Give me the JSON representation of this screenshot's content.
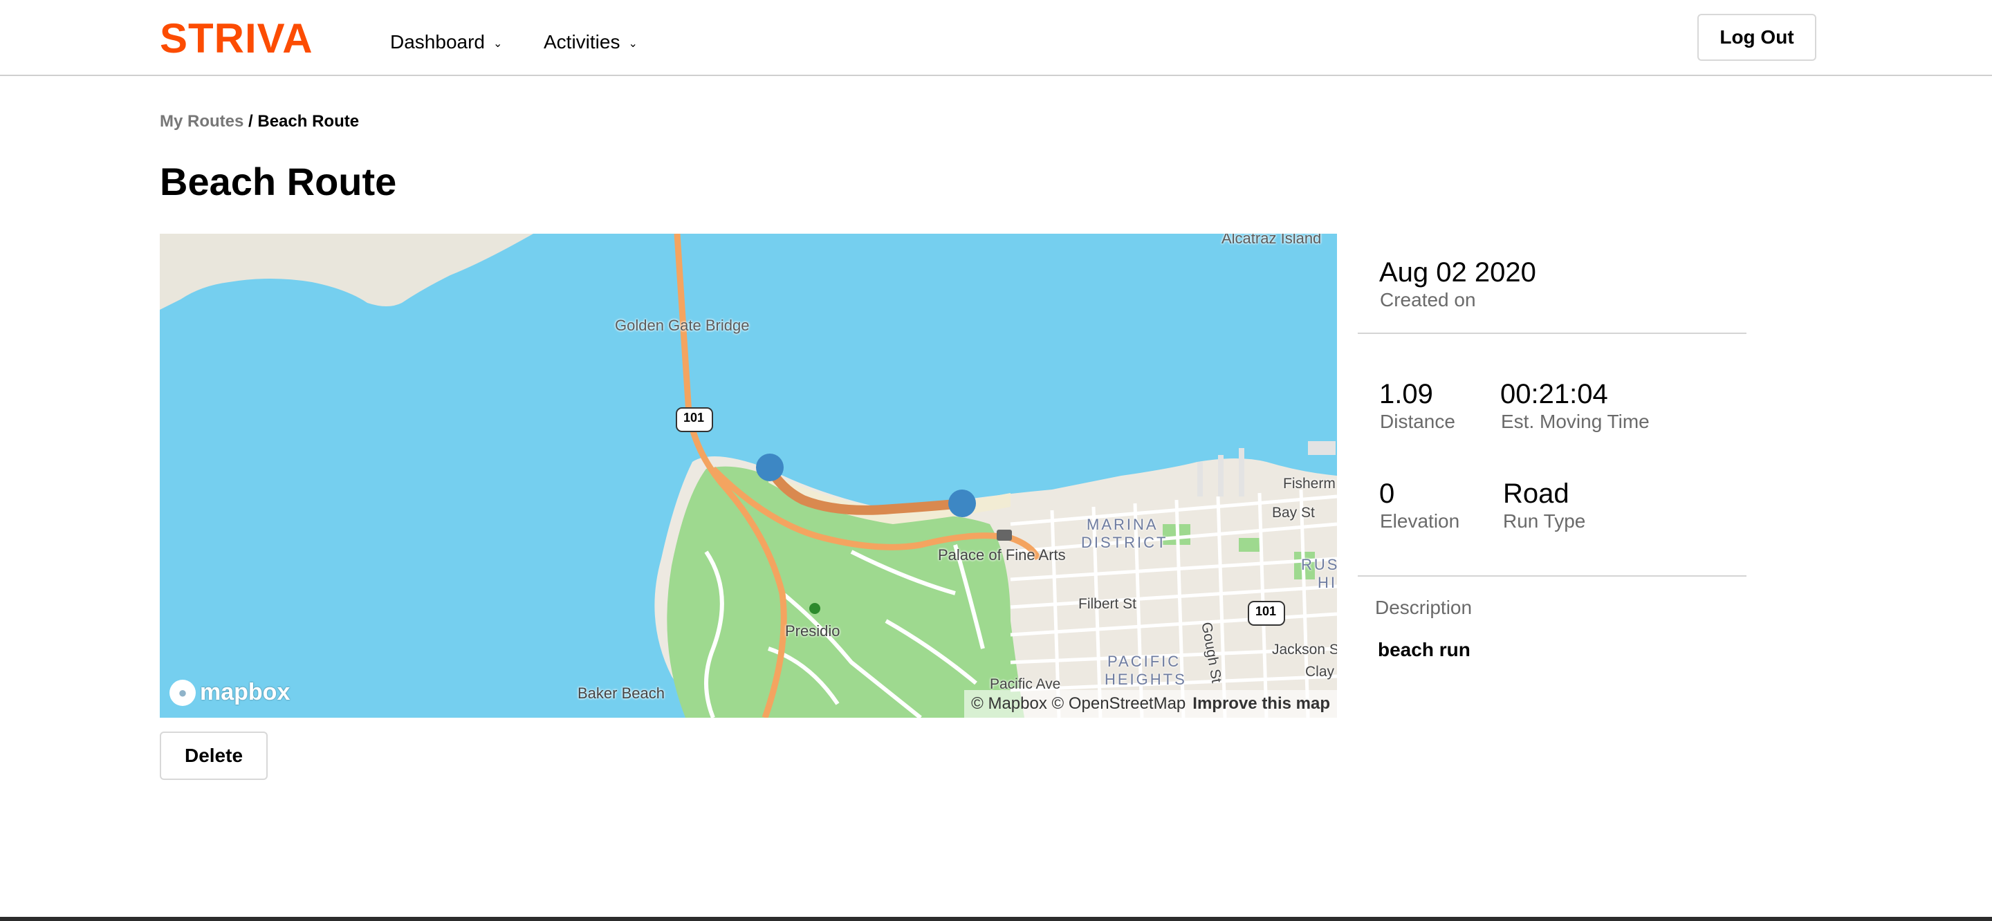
{
  "brand": {
    "logo_text": "STRIVA",
    "accent_color": "#fc4c02"
  },
  "nav": {
    "items": [
      {
        "label": "Dashboard",
        "icon": "chevron-down-icon"
      },
      {
        "label": "Activities",
        "icon": "chevron-down-icon"
      }
    ],
    "logout_label": "Log Out"
  },
  "breadcrumb": {
    "parent": "My Routes",
    "separator": " / ",
    "current": "Beach Route"
  },
  "page": {
    "title": "Beach Route"
  },
  "map": {
    "labels": {
      "alcatraz": "Alcatraz Island",
      "golden_gate": "Golden Gate Bridge",
      "highway": "101",
      "marina_1": "MARINA",
      "marina_2": "DISTRICT",
      "palace": "Palace of Fine Arts",
      "presidio": "Presidio",
      "baker_beach": "Baker Beach",
      "fishermans": "Fisherm",
      "bay_st": "Bay St",
      "filbert_st": "Filbert St",
      "gough_st": "Gough St",
      "pacific_1": "PACIFIC",
      "pacific_2": "HEIGHTS",
      "pacific_ave": "Pacific Ave",
      "jackson_st": "Jackson St",
      "clay": "Clay",
      "russ_1": "RUSS",
      "russ_2": "HI"
    },
    "logo_text": "mapbox",
    "attribution": {
      "copyright": "© Mapbox © OpenStreetMap",
      "improve": "Improve this map"
    },
    "colors": {
      "water": "#75cfef",
      "park": "#9ed98f",
      "route": "#d9894f",
      "highway": "#f4a460",
      "marker": "#3d87c4"
    }
  },
  "actions": {
    "delete_label": "Delete"
  },
  "stats": {
    "created": {
      "value": "Aug 02 2020",
      "label": "Created on"
    },
    "distance": {
      "value": "1.09",
      "label": "Distance"
    },
    "moving_time": {
      "value": "00:21:04",
      "label": "Est. Moving Time"
    },
    "elevation": {
      "value": "0",
      "label": "Elevation"
    },
    "run_type": {
      "value": "Road",
      "label": "Run Type"
    }
  },
  "description": {
    "label": "Description",
    "text": "beach run"
  }
}
